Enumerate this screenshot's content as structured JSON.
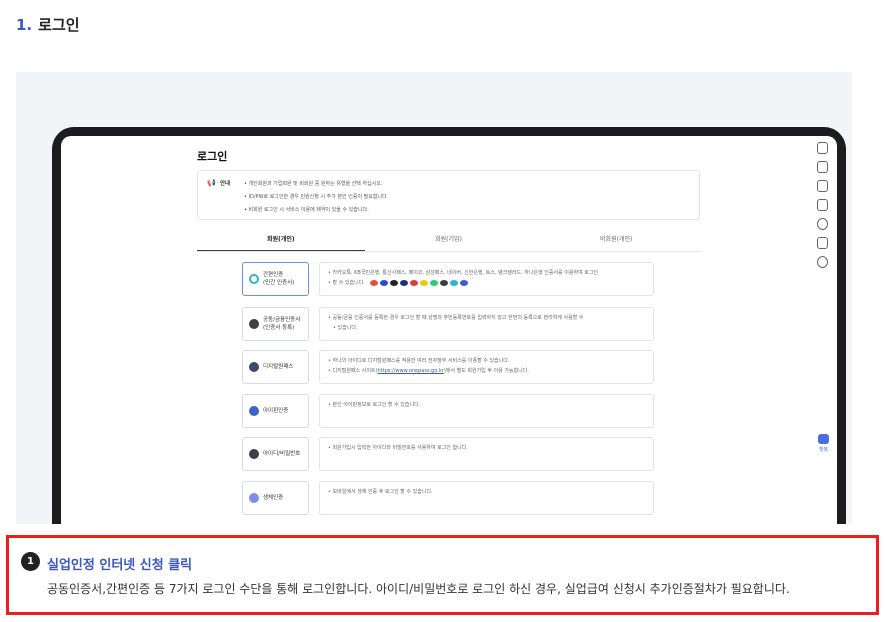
{
  "step": {
    "number": "1.",
    "title": "로그인"
  },
  "screen": {
    "title": "로그인",
    "notice": {
      "label": "안내",
      "items": [
        "개인회원과 기업회원 및 비회원 중 원하는 유형을 선택 하십시오.",
        "ID/PW로 로그인한 경우 빈원신청 시 추가 본인 인증이 필요합니다",
        "비회원 로그인 시 서비스 이용에 제약이 있을 수 있습니다."
      ]
    },
    "tabs": [
      "회원(개인)",
      "회원(기업)",
      "비회원(개인)"
    ],
    "rail_label": "챗봇",
    "methods": [
      {
        "label": "간편인증\n(민간 인증서)",
        "icon_color": "#2fb7c9",
        "desc": [
          "카카오톡, KB국민은행, 통신사패스, 페이코, 삼성패스, 네이버, 신한은행, 토스, 뱅크샐러드, 하나은행 인증서를 이용하여 로그인",
          "할 수 있습니다."
        ]
      },
      {
        "label": "공동/금융인증서\n(인증서 등록)",
        "icon_color": "#3b3f47",
        "desc": [
          "공동/금융 인증서를 등록한 경우 로그인 할 때 성명과 주민등록번호를 입력하지 않고 한번의 등록으로 편리하게 사용할 수",
          "있습니다."
        ]
      },
      {
        "label": "디지털원패스",
        "icon_color": "#3b4a6e",
        "desc": [
          "하나의 아이디로 디지털원패스를 적용한 여러 전자정부 서비스를 이용할 수 있습니다."
        ],
        "desc_link": {
          "before": "디지털원패스 사이트(",
          "url": "https://www.onepass.go.kr",
          "after": ")에서 별도 회원가입 후 이용 가능합니다."
        }
      },
      {
        "label": "아이핀인증",
        "icon_color": "#3f61c9",
        "desc": [
          "본인 아이핀정보로 로그인 할 수 있습니다."
        ]
      },
      {
        "label": "아이디/비밀번호",
        "icon_color": "#3b3f47",
        "desc": [
          "회원가입시 입력한 아이디와 비밀번호를 사용하여 로그인 합니다."
        ]
      },
      {
        "label": "생체인증",
        "icon_color": "#7b8df0",
        "desc": [
          "모바일에서 생체 인증 후 로그인 할 수 있습니다."
        ]
      }
    ],
    "provider_colors": [
      "#e74c3c",
      "#2a4bd0",
      "#222222",
      "#1f2f7a",
      "#d43f3f",
      "#f1c40f",
      "#2ecc71",
      "#3b3b3b",
      "#2ab5c9",
      "#3b5bdb"
    ]
  },
  "callout": {
    "badge": "1",
    "title": "실업인정 인터넷 신청 클릭",
    "description": "공동인증서,간편인증 등 7가지 로그인 수단을 통해 로그인합니다. 아이디/비밀번호로 로그인 하신 경우, 실업급여 신청시 추가인증절차가 필요합니다."
  }
}
